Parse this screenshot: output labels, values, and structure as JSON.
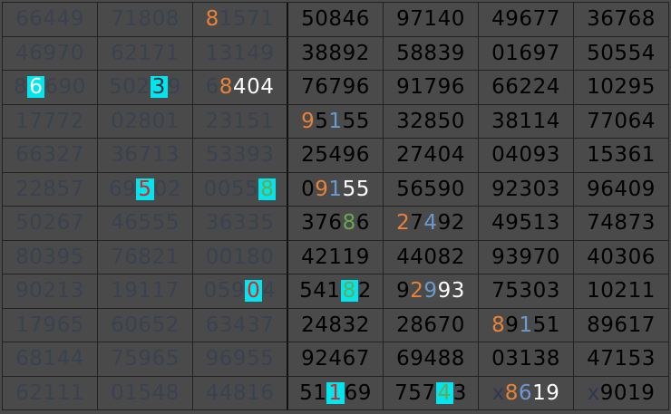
{
  "colors": {
    "background": "#4a4a4a",
    "dim_text": "#3a4250",
    "normal_text": "#000000",
    "orange": "#e8823a",
    "blue": "#6a9ad0",
    "white": "#ffffff",
    "green": "#6aa84f",
    "red": "#e02020",
    "cyan_highlight": "#00e5ee",
    "x_prefix": "#303850"
  },
  "grid": {
    "columns": 7,
    "rows": [
      [
        "66449",
        "71808",
        "81571",
        "50846",
        "97140",
        "49677",
        "36768"
      ],
      [
        "46970",
        "62171",
        "13149",
        "38892",
        "58839",
        "01697",
        "50554"
      ],
      [
        "86690",
        "50239",
        "68404",
        "76796",
        "91796",
        "66224",
        "10295"
      ],
      [
        "17772",
        "02801",
        "23151",
        "95155",
        "32850",
        "38114",
        "77064"
      ],
      [
        "66327",
        "36713",
        "53393",
        "25496",
        "27404",
        "04093",
        "15361"
      ],
      [
        "22857",
        "69502",
        "00558",
        "09155",
        "56590",
        "92303",
        "96409"
      ],
      [
        "50267",
        "46555",
        "36335",
        "37686",
        "27492",
        "49513",
        "74873"
      ],
      [
        "80395",
        "76821",
        "00180",
        "42119",
        "44082",
        "93970",
        "40306"
      ],
      [
        "90213",
        "19117",
        "05904",
        "54182",
        "92993",
        "75303",
        "10211"
      ],
      [
        "17965",
        "60652",
        "63437",
        "24832",
        "28670",
        "89151",
        "89617"
      ],
      [
        "68144",
        "75965",
        "96955",
        "92467",
        "69488",
        "03138",
        "47153"
      ],
      [
        "62111",
        "01548",
        "44816",
        "51169",
        "75743",
        "x8619",
        "x9019"
      ]
    ],
    "dim_columns": [
      0,
      1,
      2
    ]
  },
  "styling": {
    "0,2": [
      [
        "orange",
        0
      ]
    ],
    "2,0": [
      [
        "cyan-white",
        1
      ]
    ],
    "2,1": [
      [
        "cyan-dark",
        3
      ]
    ],
    "2,2": [
      [
        "orange",
        1
      ],
      [
        "white",
        2
      ],
      [
        "white",
        3
      ],
      [
        "white",
        4
      ]
    ],
    "3,3": [
      [
        "orange",
        0
      ],
      [
        "blue",
        2
      ]
    ],
    "5,1": [
      [
        "cyan-red",
        2
      ]
    ],
    "5,2": [
      [
        "cyan-green",
        4
      ]
    ],
    "5,3": [
      [
        "orange",
        1
      ],
      [
        "blue",
        2
      ],
      [
        "white",
        3
      ],
      [
        "white",
        4
      ]
    ],
    "6,3": [
      [
        "green",
        3
      ]
    ],
    "6,4": [
      [
        "orange",
        0
      ],
      [
        "blue",
        2
      ]
    ],
    "8,2": [
      [
        "cyan-red",
        3
      ]
    ],
    "8,3": [
      [
        "cyan-green",
        3
      ]
    ],
    "8,4": [
      [
        "orange",
        1
      ],
      [
        "blue",
        2
      ],
      [
        "white",
        3
      ],
      [
        "white",
        4
      ]
    ],
    "9,5": [
      [
        "orange",
        0
      ],
      [
        "blue",
        2
      ]
    ],
    "11,3": [
      [
        "cyan-red",
        2
      ]
    ],
    "11,4": [
      [
        "cyan-green",
        3
      ]
    ],
    "11,5": [
      [
        "xprefix",
        0
      ],
      [
        "orange",
        1
      ],
      [
        "blue",
        2
      ],
      [
        "white",
        3
      ],
      [
        "white",
        4
      ]
    ],
    "11,6": [
      [
        "xprefix",
        0
      ]
    ]
  }
}
